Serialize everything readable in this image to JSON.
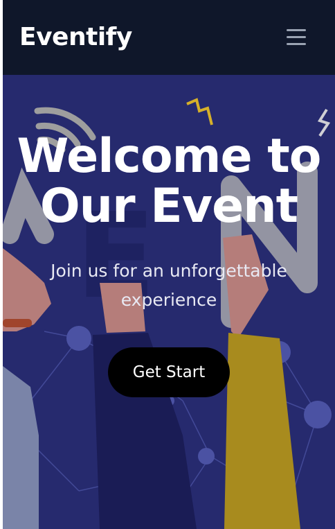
{
  "navbar": {
    "brand": "Eventify",
    "menu_icon": "hamburger-menu-icon"
  },
  "hero": {
    "title_line1": "Welcome to",
    "title_line2": "Our Event",
    "subtitle": "Join us for an unforgettable experience",
    "cta_label": "Get Start"
  },
  "colors": {
    "navbar_bg": "#0f172a",
    "hero_bg": "#262a6e",
    "button_bg": "#000000",
    "text": "#ffffff"
  }
}
